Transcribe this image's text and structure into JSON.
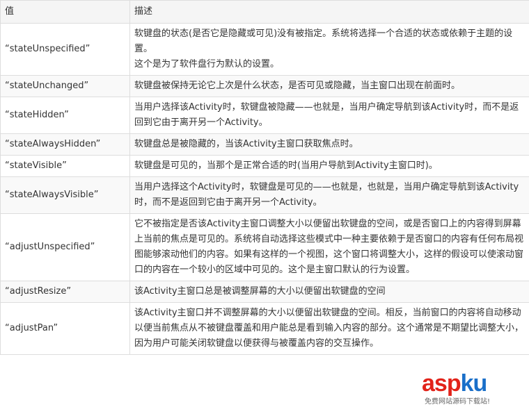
{
  "header": {
    "col_value": "值",
    "col_desc": "描述"
  },
  "rows": [
    {
      "value": "“stateUnspecified”",
      "desc": [
        "软键盘的状态(是否它是隐藏或可见)没有被指定。系统将选择一个合适的状态或依赖于主题的设置。",
        "这个是为了软件盘行为默认的设置。"
      ]
    },
    {
      "value": "“stateUnchanged”",
      "desc": [
        "软键盘被保持无论它上次是什么状态，是否可见或隐藏，当主窗口出现在前面时。"
      ]
    },
    {
      "value": "“stateHidden”",
      "desc": [
        "当用户选择该Activity时，软键盘被隐藏——也就是，当用户确定导航到该Activity时，而不是返回到它由于离开另一个Activity。"
      ]
    },
    {
      "value": "“stateAlwaysHidden”",
      "desc": [
        "软键盘总是被隐藏的，当该Activity主窗口获取焦点时。"
      ]
    },
    {
      "value": "“stateVisible”",
      "desc": [
        "软键盘是可见的，当那个是正常合适的时(当用户导航到Activity主窗口时)。"
      ]
    },
    {
      "value": "“stateAlwaysVisible”",
      "desc": [
        "当用户选择这个Activity时，软键盘是可见的——也就是，也就是，当用户确定导航到该Activity时，而不是返回到它由于离开另一个Activity。"
      ]
    },
    {
      "value": "“adjustUnspecified”",
      "desc": [
        "它不被指定是否该Activity主窗口调整大小以便留出软键盘的空间，或是否窗口上的内容得到屏幕上当前的焦点是可见的。系统将自动选择这些模式中一种主要依赖于是否窗口的内容有任何布局视图能够滚动他们的内容。如果有这样的一个视图，这个窗口将调整大小，这样的假设可以使滚动窗口的内容在一个较小的区域中可见的。这个是主窗口默认的行为设置。"
      ]
    },
    {
      "value": "“adjustResize”",
      "desc": [
        "该Activity主窗口总是被调整屏幕的大小以便留出软键盘的空间"
      ]
    },
    {
      "value": "“adjustPan”",
      "desc": [
        "该Activity主窗口并不调整屏幕的大小以便留出软键盘的空间。相反，当前窗口的内容将自动移动以便当前焦点从不被键盘覆盖和用户能总是看到输入内容的部分。这个通常是不期望比调整大小，因为用户可能关闭软键盘以便获得与被覆盖内容的交互操作。"
      ]
    }
  ],
  "watermark": {
    "logo": "aspku",
    "sub": "免费网站源码下载站!"
  }
}
